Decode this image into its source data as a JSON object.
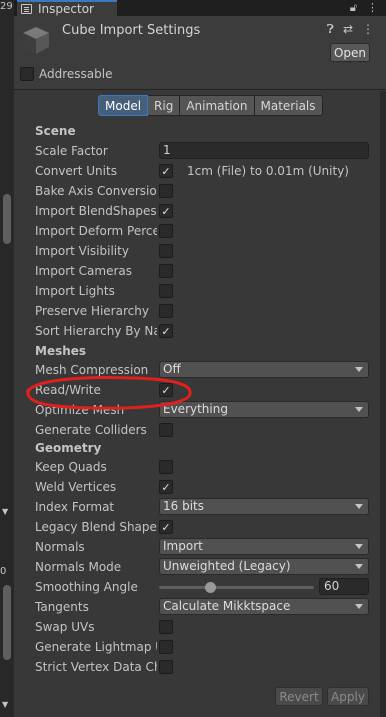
{
  "left_strip": {
    "top_num": "29",
    "mid_num": "0"
  },
  "tab": {
    "title": "Inspector",
    "icons": [
      "lock-icon",
      "more-icon"
    ]
  },
  "header": {
    "title": "Cube Import Settings",
    "icons": [
      "help-icon",
      "settings-sliders-icon",
      "more-icon"
    ],
    "open_label": "Open",
    "addressable_label": "Addressable",
    "addressable_checked": false
  },
  "model_tabs": [
    "Model",
    "Rig",
    "Animation",
    "Materials"
  ],
  "active_tab": "Model",
  "sections": {
    "scene": "Scene",
    "meshes": "Meshes",
    "geometry": "Geometry"
  },
  "scene": {
    "scale_factor": {
      "label": "Scale Factor",
      "value": "1"
    },
    "convert_units": {
      "label": "Convert Units",
      "checked": true,
      "note": "1cm (File) to 0.01m (Unity)"
    },
    "bake_axis": {
      "label": "Bake Axis Conversion",
      "checked": false
    },
    "import_blendshapes": {
      "label": "Import BlendShapes",
      "checked": true
    },
    "import_deform": {
      "label": "Import Deform Percent",
      "checked": false
    },
    "import_visibility": {
      "label": "Import Visibility",
      "checked": false
    },
    "import_cameras": {
      "label": "Import Cameras",
      "checked": false
    },
    "import_lights": {
      "label": "Import Lights",
      "checked": false
    },
    "preserve_hierarchy": {
      "label": "Preserve Hierarchy",
      "checked": false
    },
    "sort_hierarchy": {
      "label": "Sort Hierarchy By Name",
      "checked": true
    }
  },
  "meshes": {
    "mesh_compression": {
      "label": "Mesh Compression",
      "value": "Off"
    },
    "read_write": {
      "label": "Read/Write",
      "checked": true
    },
    "optimize_mesh": {
      "label": "Optimize Mesh",
      "value": "Everything"
    },
    "generate_colliders": {
      "label": "Generate Colliders",
      "checked": false
    }
  },
  "geometry": {
    "keep_quads": {
      "label": "Keep Quads",
      "checked": false
    },
    "weld_vertices": {
      "label": "Weld Vertices",
      "checked": true
    },
    "index_format": {
      "label": "Index Format",
      "value": "16 bits"
    },
    "legacy_blend": {
      "label": "Legacy Blend Shape Normals",
      "checked": true
    },
    "normals": {
      "label": "Normals",
      "value": "Import"
    },
    "normals_mode": {
      "label": "Normals Mode",
      "value": "Unweighted (Legacy)"
    },
    "smoothing_angle": {
      "label": "Smoothing Angle",
      "value": "60",
      "fraction": 0.33
    },
    "tangents": {
      "label": "Tangents",
      "value": "Calculate Mikktspace"
    },
    "swap_uvs": {
      "label": "Swap UVs",
      "checked": false
    },
    "lightmap_uvs": {
      "label": "Generate Lightmap UVs",
      "checked": false
    },
    "strict_vertex": {
      "label": "Strict Vertex Data Checks",
      "checked": false
    }
  },
  "footer": {
    "revert_label": "Revert",
    "apply_label": "Apply"
  },
  "colors": {
    "accent": "#3a79bb",
    "highlight_circle": "#e0201e",
    "panel": "#383838"
  }
}
